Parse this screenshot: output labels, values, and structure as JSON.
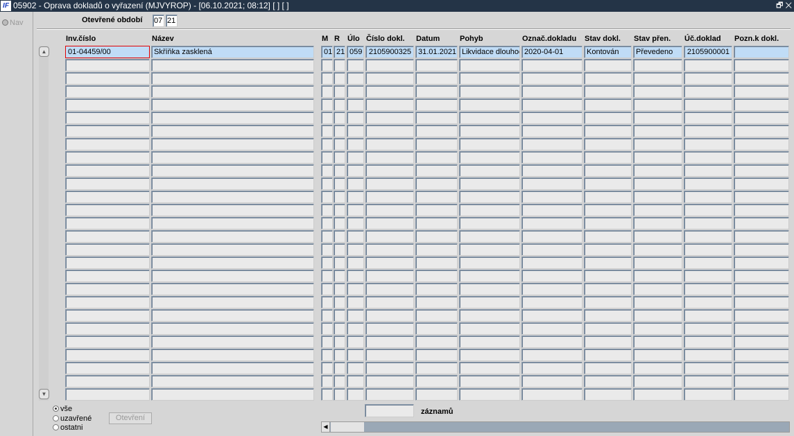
{
  "window": {
    "logo": "IF",
    "title": "05902 - Oprava dokladů o vyřazení (MJVYROP) - [06.10.2021; 08:12]  [ ]  [ ]",
    "controls": "🗗 ✕"
  },
  "nav": {
    "label": "Nav"
  },
  "period": {
    "label": "Otevřené období",
    "month": "07",
    "year": "21"
  },
  "columns": [
    "Inv.číslo",
    "Název",
    "M",
    "R",
    "Úlo",
    "Číslo dokl.",
    "Datum",
    "Pohyb",
    "Označ.dokladu",
    "Stav dokl.",
    "Stav přen.",
    "Úč.doklad",
    "Pozn.k dokl."
  ],
  "rows": [
    [
      "01-04459/00",
      "Skříňka zasklená",
      "01",
      "21",
      "059",
      "2105900325",
      "31.01.2021",
      "Likvidace dlouhod",
      "2020-04-01",
      "Kontován",
      "Převedeno",
      "2105900001",
      ""
    ]
  ],
  "empty_rows": 26,
  "filter": {
    "options": [
      "vše",
      "uzavřené",
      "ostatni"
    ],
    "selected": "vše"
  },
  "open_button": "Otevření",
  "records": {
    "value": "",
    "label": "záznamů"
  }
}
